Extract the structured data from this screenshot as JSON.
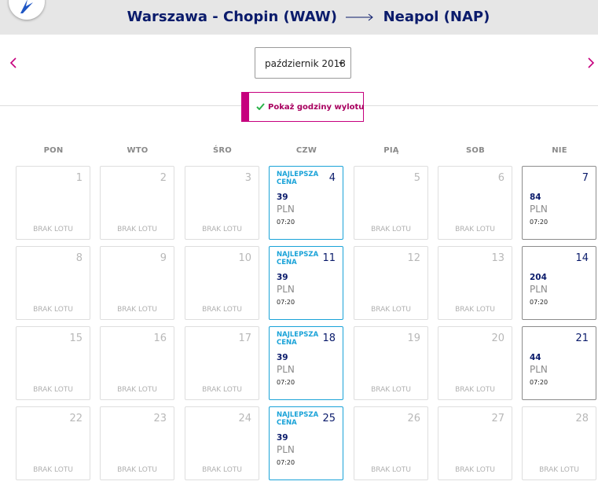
{
  "header": {
    "origin": "Warszawa - Chopin (WAW)",
    "destination": "Neapol (NAP)"
  },
  "month_select": {
    "value": "październik 2018"
  },
  "toggle": {
    "label": "Pokaż godziny wylotu"
  },
  "weekdays": [
    "PON",
    "WTO",
    "ŚRO",
    "CZW",
    "PIĄ",
    "SOB",
    "NIE"
  ],
  "labels": {
    "no_flight": "BRAK LOTU",
    "best_price_line1": "NAJLEPSZA",
    "best_price_line2": "CENA",
    "currency": "PLN"
  },
  "colors": {
    "brand_navy": "#0a1b6b",
    "accent_magenta": "#c6007e",
    "best_price_blue": "#1aa3d8"
  },
  "days": [
    {
      "day": "1",
      "status": "none"
    },
    {
      "day": "2",
      "status": "none"
    },
    {
      "day": "3",
      "status": "none"
    },
    {
      "day": "4",
      "status": "best",
      "price": "39",
      "time": "07:20"
    },
    {
      "day": "5",
      "status": "none"
    },
    {
      "day": "6",
      "status": "none"
    },
    {
      "day": "7",
      "status": "avail",
      "price": "84",
      "time": "07:20"
    },
    {
      "day": "8",
      "status": "none"
    },
    {
      "day": "9",
      "status": "none"
    },
    {
      "day": "10",
      "status": "none"
    },
    {
      "day": "11",
      "status": "best",
      "price": "39",
      "time": "07:20"
    },
    {
      "day": "12",
      "status": "none"
    },
    {
      "day": "13",
      "status": "none"
    },
    {
      "day": "14",
      "status": "avail",
      "price": "204",
      "time": "07:20"
    },
    {
      "day": "15",
      "status": "none"
    },
    {
      "day": "16",
      "status": "none"
    },
    {
      "day": "17",
      "status": "none"
    },
    {
      "day": "18",
      "status": "best",
      "price": "39",
      "time": "07:20"
    },
    {
      "day": "19",
      "status": "none"
    },
    {
      "day": "20",
      "status": "none"
    },
    {
      "day": "21",
      "status": "avail",
      "price": "44",
      "time": "07:20"
    },
    {
      "day": "22",
      "status": "none"
    },
    {
      "day": "23",
      "status": "none"
    },
    {
      "day": "24",
      "status": "none"
    },
    {
      "day": "25",
      "status": "best",
      "price": "39",
      "time": "07:20"
    },
    {
      "day": "26",
      "status": "none"
    },
    {
      "day": "27",
      "status": "none"
    },
    {
      "day": "28",
      "status": "none"
    }
  ]
}
